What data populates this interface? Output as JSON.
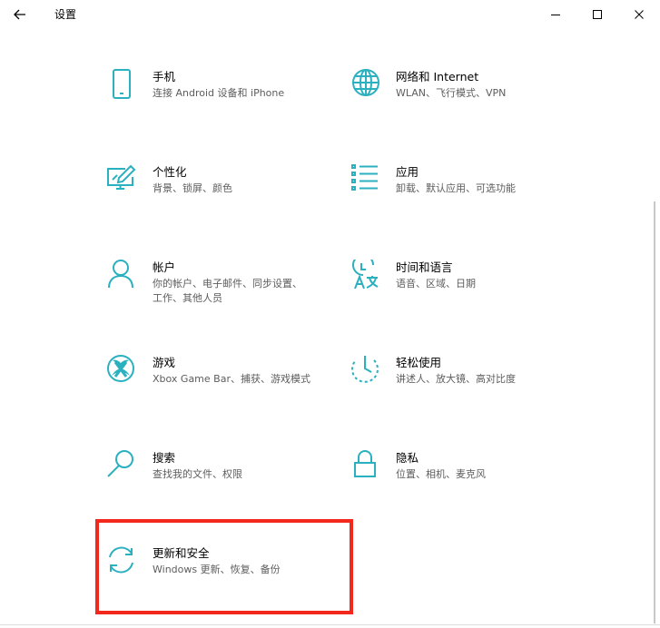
{
  "window": {
    "title": "设置",
    "accent_color": "#2bb0c0",
    "highlight_color": "#f2281d"
  },
  "tiles": [
    {
      "name": "手机",
      "desc": "连接 Android 设备和 iPhone",
      "icon": "phone-icon"
    },
    {
      "name": "网络和 Internet",
      "desc": "WLAN、飞行模式、VPN",
      "icon": "globe-icon"
    },
    {
      "name": "个性化",
      "desc": "背景、锁屏、颜色",
      "icon": "personalization-icon"
    },
    {
      "name": "应用",
      "desc": "卸载、默认应用、可选功能",
      "icon": "apps-list-icon"
    },
    {
      "name": "帐户",
      "desc": "你的帐户、电子邮件、同步设置、工作、其他人员",
      "icon": "person-icon"
    },
    {
      "name": "时间和语言",
      "desc": "语音、区域、日期",
      "icon": "time-language-icon"
    },
    {
      "name": "游戏",
      "desc": "Xbox Game Bar、捕获、游戏模式",
      "icon": "xbox-icon"
    },
    {
      "name": "轻松使用",
      "desc": "讲述人、放大镜、高对比度",
      "icon": "ease-of-access-icon"
    },
    {
      "name": "搜索",
      "desc": "查找我的文件、权限",
      "icon": "search-icon"
    },
    {
      "name": "隐私",
      "desc": "位置、相机、麦克风",
      "icon": "lock-icon"
    },
    {
      "name": "更新和安全",
      "desc": "Windows 更新、恢复、备份",
      "icon": "sync-icon"
    }
  ]
}
